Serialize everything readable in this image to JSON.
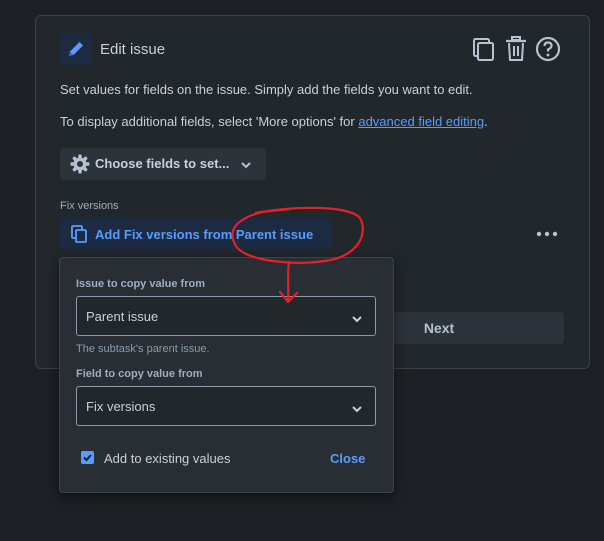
{
  "header": {
    "title": "Edit issue",
    "icons": [
      "pencil-icon",
      "copy-icon",
      "trash-icon",
      "help-icon"
    ]
  },
  "intro": {
    "line1": "Set values for fields on the issue. Simply add the fields you want to edit.",
    "line2_prefix": "To display additional fields, select 'More options' for ",
    "line2_link": "advanced field editing",
    "line2_suffix": "."
  },
  "choose_fields": {
    "label": "Choose fields to set..."
  },
  "fix_versions": {
    "label": "Fix versions",
    "button_label": "Add Fix versions from Parent issue"
  },
  "next_button": {
    "label": "Next"
  },
  "popup": {
    "issue_label": "Issue to copy value from",
    "issue_value": "Parent issue",
    "issue_helper": "The subtask's parent issue.",
    "field_label": "Field to copy value from",
    "field_value": "Fix versions",
    "checkbox_label": "Add to existing values",
    "checkbox_checked": true,
    "close_label": "Close"
  },
  "colors": {
    "accent": "#579dff",
    "annotation": "#e5202a",
    "background": "#1d2125"
  }
}
